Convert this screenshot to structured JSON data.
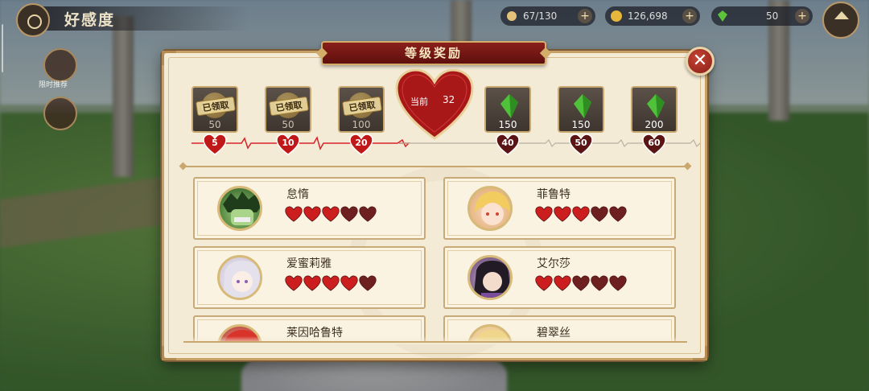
{
  "hud": {
    "title": "好感度",
    "resources": [
      {
        "icon": "stamina-icon",
        "value": "67/130"
      },
      {
        "icon": "gold-icon",
        "value": "126,698"
      },
      {
        "icon": "green-crystal-icon",
        "value": "50"
      }
    ],
    "left_side": [
      {
        "icon": "event-icon",
        "label": "限时推荐"
      },
      {
        "icon": "locked-icon",
        "label": ""
      }
    ]
  },
  "dialog": {
    "title": "等级奖励",
    "current_label": "当前",
    "current_value": "32",
    "claimed_label": "已领取",
    "rewards": [
      {
        "level": "5",
        "amount": "50",
        "kind": "gold",
        "claimed": true
      },
      {
        "level": "10",
        "amount": "50",
        "kind": "gold",
        "claimed": true
      },
      {
        "level": "20",
        "amount": "100",
        "kind": "gold",
        "claimed": true
      },
      {
        "level": "40",
        "amount": "150",
        "kind": "crystal",
        "claimed": false
      },
      {
        "level": "50",
        "amount": "150",
        "kind": "crystal",
        "claimed": false
      },
      {
        "level": "60",
        "amount": "200",
        "kind": "crystal",
        "claimed": false
      }
    ]
  },
  "characters": [
    {
      "name": "怠惰",
      "hearts_filled": 3,
      "hearts_total": 5,
      "portrait": "green-hair-villain"
    },
    {
      "name": "菲鲁特",
      "hearts_filled": 3,
      "hearts_total": 5,
      "portrait": "blonde-girl"
    },
    {
      "name": "爱蜜莉雅",
      "hearts_filled": 4,
      "hearts_total": 5,
      "portrait": "silver-hair-elf"
    },
    {
      "name": "艾尔莎",
      "hearts_filled": 2,
      "hearts_total": 5,
      "portrait": "dark-hair-woman"
    },
    {
      "name": "莱因哈鲁特",
      "hearts_filled": 0,
      "hearts_total": 5,
      "portrait": "red-hair-knight"
    },
    {
      "name": "碧翠丝",
      "hearts_filled": 0,
      "hearts_total": 5,
      "portrait": "blonde-twin-tails"
    }
  ],
  "colors": {
    "heart_filled": "#cc1e1e",
    "heart_empty": "#6e2020",
    "accent_gold": "#c9a870",
    "banner_red": "#8b1f1a"
  }
}
